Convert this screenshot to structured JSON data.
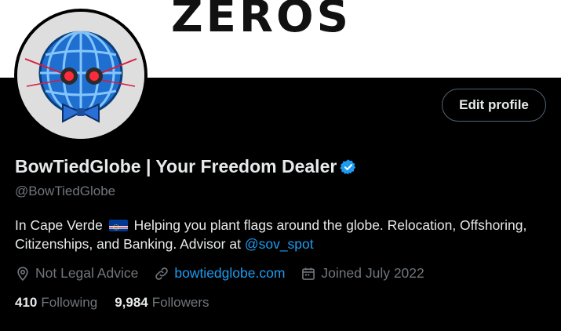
{
  "banner": {
    "text": "ZEROS"
  },
  "profile": {
    "name": "BowTiedGlobe | Your Freedom Dealer",
    "handle": "@BowTiedGlobe",
    "verified": true,
    "bio_part1": "In Cape Verde",
    "bio_part2": "Helping you plant flags around the globe. Relocation, Offshoring, Citizenships, and Banking. Advisor at",
    "bio_mention": "@sov_spot",
    "location": "Not Legal Advice",
    "website": "bowtiedglobe.com",
    "joined": "Joined July 2022",
    "following_count": "410",
    "following_label": "Following",
    "followers_count": "9,984",
    "followers_label": "Followers"
  },
  "actions": {
    "edit_profile": "Edit profile"
  },
  "icons": {
    "verified": "verified-badge-icon",
    "location": "location-pin-icon",
    "link": "link-icon",
    "calendar": "calendar-icon",
    "flag": "cape-verde-flag-icon"
  },
  "colors": {
    "accent": "#1d9bf0",
    "background": "#000000",
    "muted": "#71767b",
    "text": "#e7e9ea"
  }
}
